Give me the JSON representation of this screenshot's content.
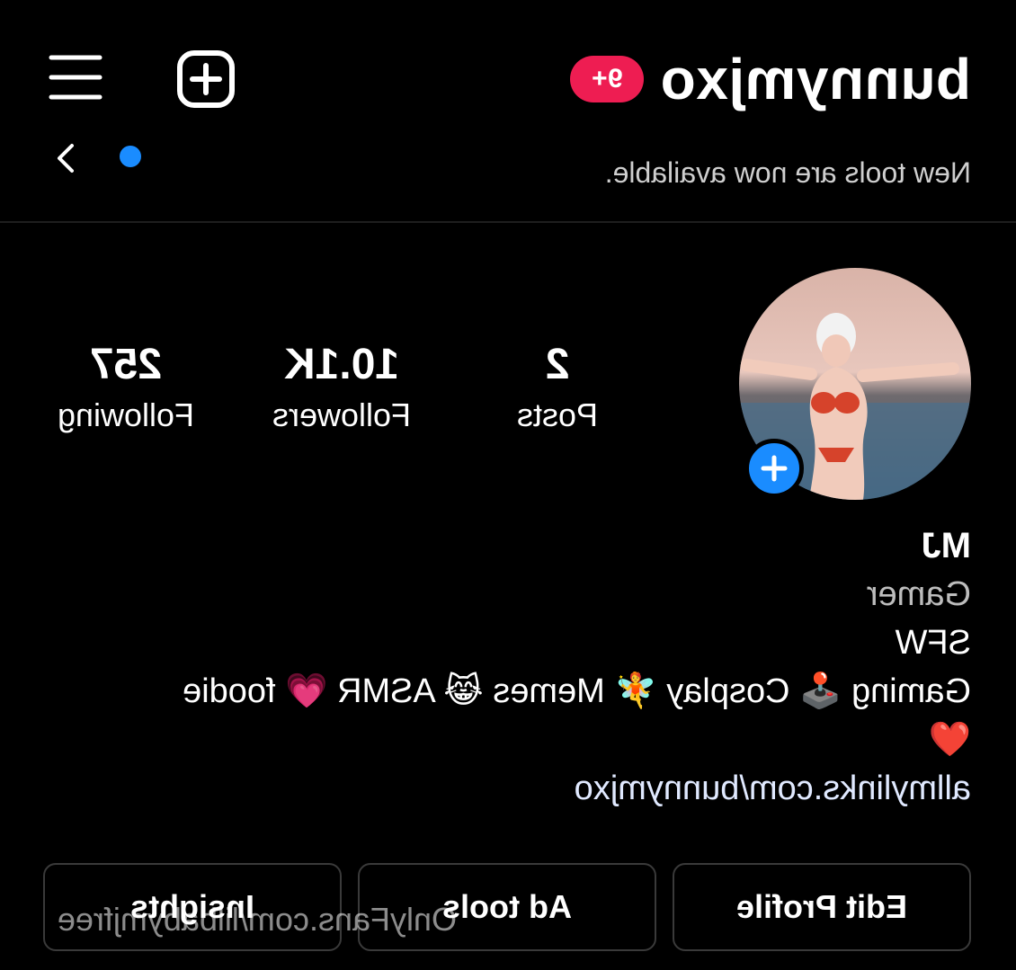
{
  "header": {
    "username": "bunnymjxo",
    "notification_badge": "9+",
    "subtitle": "New tools are now available.",
    "icons": {
      "menu": "hamburger-menu-icon",
      "create": "add-box-icon",
      "back": "chevron-icon",
      "indicator": "blue-dot-icon"
    }
  },
  "profile": {
    "stats": [
      {
        "value": "2",
        "label": "Posts"
      },
      {
        "value": "10.1K",
        "label": "Followers"
      },
      {
        "value": "257",
        "label": "Following"
      }
    ],
    "bio": {
      "name": "MJ",
      "category": "Gamer",
      "line1": "SFW",
      "line2": "Gaming 🕹️ Cosplay 🧚 Memes 😹 ASMR 💗 foodie",
      "line3": "❤️",
      "link": "allmylinks.com/bunnymjxo"
    }
  },
  "actions": {
    "edit_profile": "Edit Profile",
    "ad_tools": "Ad tools",
    "insights": "Insights"
  },
  "watermark": "OnlyFans.com/lilbabymjfree",
  "colors": {
    "background": "#000000",
    "badge": "#ee1d52",
    "accent_blue": "#1a8cff",
    "button_border": "#3a3a3a"
  }
}
